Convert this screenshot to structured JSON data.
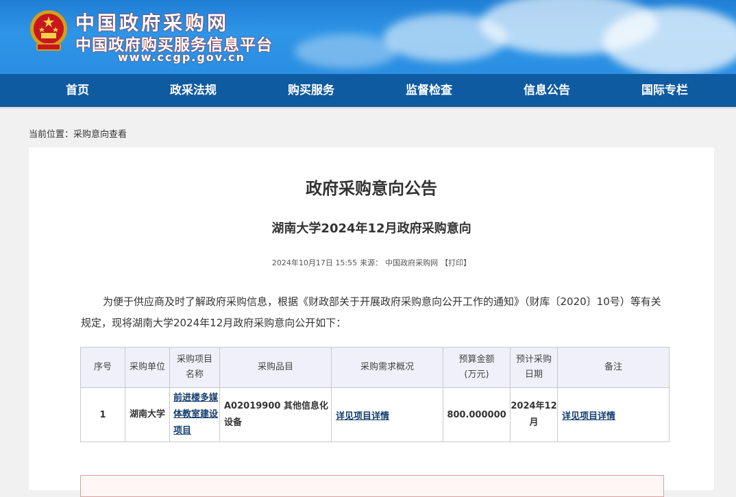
{
  "header": {
    "site_title": "中国政府采购网",
    "site_subtitle": "中国政府购买服务信息平台",
    "site_url": "www.ccgp.gov.cn"
  },
  "nav": {
    "items": [
      "首页",
      "政采法规",
      "购买服务",
      "监督检查",
      "信息公告",
      "国际专栏"
    ]
  },
  "breadcrumb": {
    "prefix": "当前位置：",
    "current": "采购意向查看"
  },
  "article": {
    "title": "政府采购意向公告",
    "subtitle": "湖南大学2024年12月政府采购意向",
    "datetime": "2024年10月17日 15:55",
    "source_label": "来源：",
    "source": "中国政府采购网",
    "print": "【打印】",
    "intro": "为便于供应商及时了解政府采购信息，根据《财政部关于开展政府采购意向公开工作的通知》（财库〔2020〕10号）等有关规定，现将湖南大学2024年12月政府采购意向公开如下："
  },
  "table": {
    "headers": [
      "序号",
      "采购单位",
      "采购项目名称",
      "采购品目",
      "采购需求概况",
      "预算金额(万元)",
      "预计采购日期",
      "备注"
    ],
    "rows": [
      {
        "index": "1",
        "unit": "湖南大学",
        "project": "前进楼多媒体教室建设项目",
        "category": "A02019900 其他信息化设备",
        "demand": "详见项目详情",
        "budget": "800.000000",
        "date": "2024年12月",
        "remark": "详见项目详情"
      }
    ]
  },
  "colors": {
    "nav_bg": "#0f5ba1",
    "banner_bg": "#2a8ee2",
    "link": "#123d6e",
    "table_header_bg": "#f0f0fb"
  }
}
